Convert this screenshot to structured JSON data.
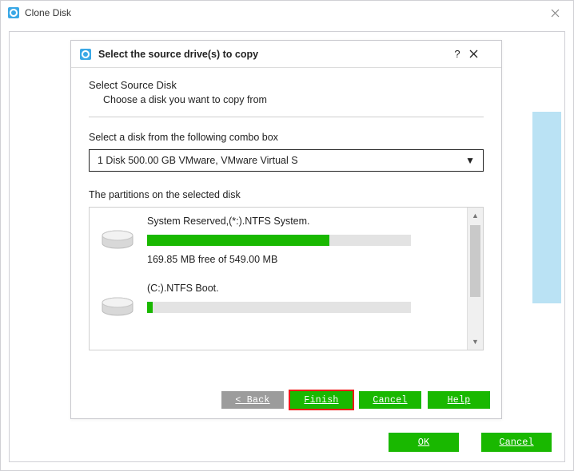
{
  "outer": {
    "title": "Clone Disk",
    "buttons": {
      "ok": "OK",
      "cancel": "Cancel"
    }
  },
  "dialog": {
    "title": "Select the source drive(s) to copy",
    "heading": "Select Source Disk",
    "subheading": "Choose a disk you want to copy from",
    "combo_label": "Select a disk from the following combo box",
    "combo_value": "1 Disk 500.00 GB VMware,  VMware Virtual S",
    "partitions_label": "The partitions on the selected disk",
    "partitions": [
      {
        "title": "System Reserved,(*:).NTFS System.",
        "free_text": "169.85 MB free of 549.00 MB",
        "used_pct": 69
      },
      {
        "title": "(C:).NTFS Boot.",
        "free_text": "",
        "used_pct": 2
      }
    ],
    "buttons": {
      "back": "< Back",
      "finish": "Finish",
      "cancel": "Cancel",
      "help": "Help"
    }
  }
}
